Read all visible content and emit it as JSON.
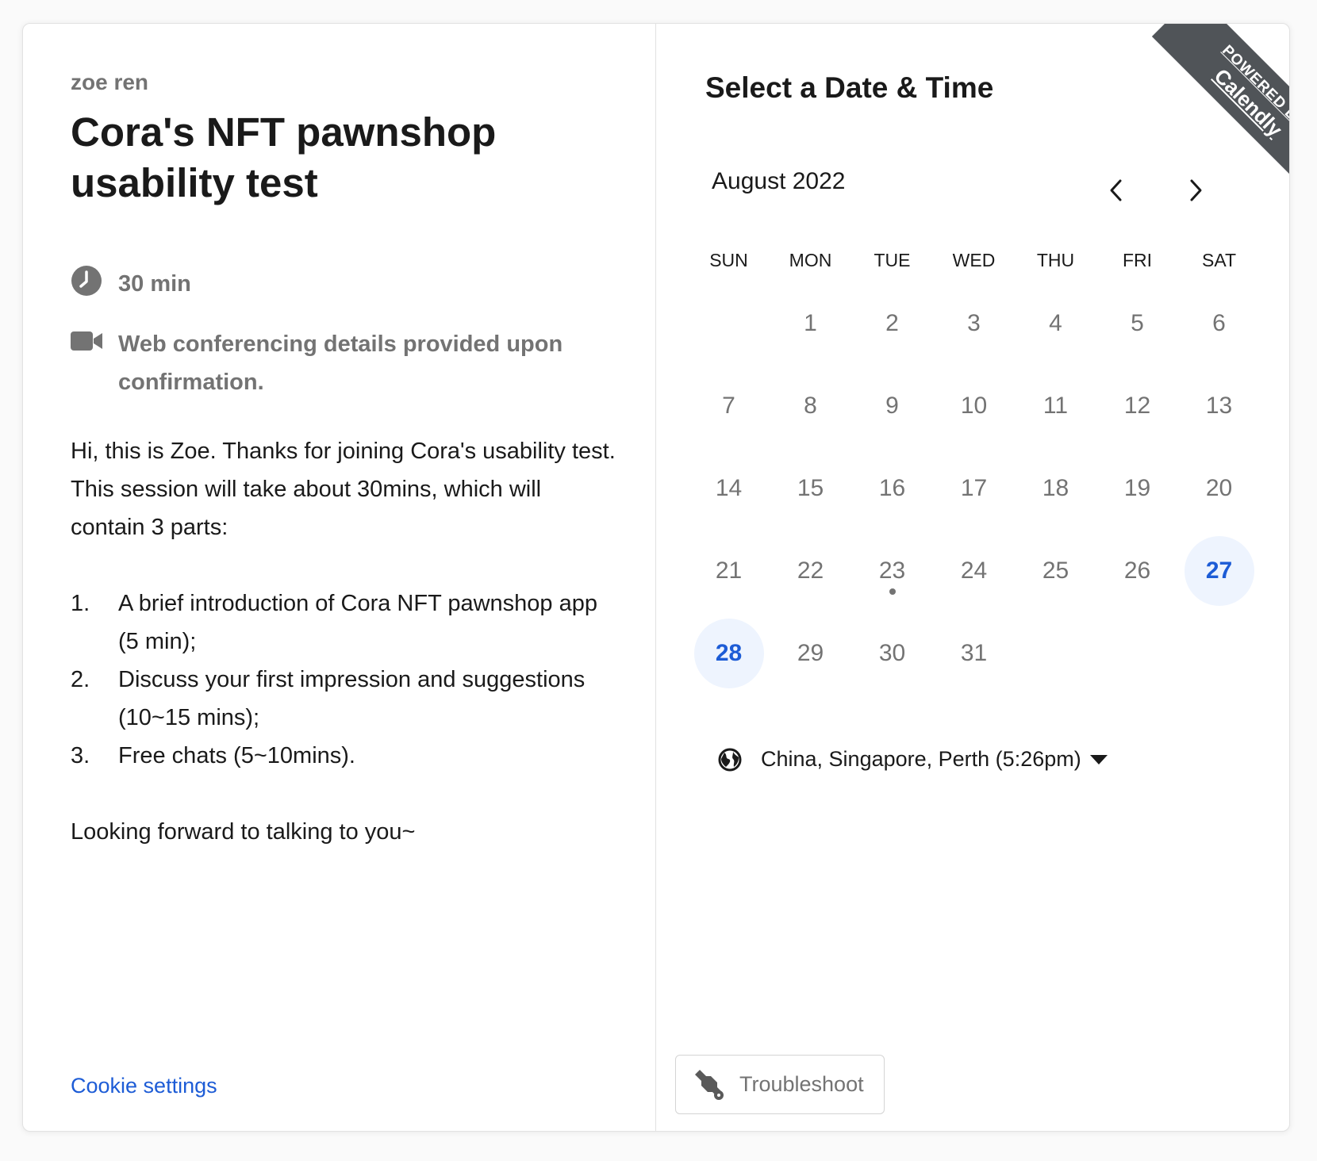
{
  "organizer": "zoe ren",
  "event": {
    "title": "Cora's NFT pawnshop usability test",
    "duration": "30 min",
    "conferencing": "Web conferencing details provided upon confirmation."
  },
  "description": {
    "intro": "Hi, this is Zoe. Thanks for joining Cora's usability test. This session will take about 30mins, which will contain 3 parts:",
    "items": [
      {
        "num": "1.",
        "text": "A brief introduction of Cora NFT pawnshop app (5 min);"
      },
      {
        "num": "2.",
        "text": "Discuss your first impression and suggestions (10~15 mins);"
      },
      {
        "num": "3.",
        "text": "Free chats (5~10mins)."
      }
    ],
    "closing": "Looking forward to talking to you~"
  },
  "cookie_label": "Cookie settings",
  "picker": {
    "title": "Select a Date & Time",
    "month": "August 2022",
    "weekdays": [
      "SUN",
      "MON",
      "TUE",
      "WED",
      "THU",
      "FRI",
      "SAT"
    ],
    "first_weekday_index": 1,
    "days": [
      "1",
      "2",
      "3",
      "4",
      "5",
      "6",
      "7",
      "8",
      "9",
      "10",
      "11",
      "12",
      "13",
      "14",
      "15",
      "16",
      "17",
      "18",
      "19",
      "20",
      "21",
      "22",
      "23",
      "24",
      "25",
      "26",
      "27",
      "28",
      "29",
      "30",
      "31"
    ],
    "available_days": [
      "27",
      "28"
    ],
    "today": "23"
  },
  "timezone": "China, Singapore, Perth (5:26pm)",
  "troubleshoot_label": "Troubleshoot",
  "ribbon": {
    "line1": "POWERED BY",
    "line2": "Calendly"
  },
  "colors": {
    "accent": "#1d5cd6",
    "available_bg": "#eef4fe",
    "muted": "#737373",
    "ribbon": "#505458"
  },
  "icons": {
    "duration": "clock-icon",
    "conferencing": "video-camera-icon",
    "prev": "chevron-left-icon",
    "next": "chevron-right-icon",
    "timezone": "globe-icon",
    "timezone_caret": "caret-down-icon",
    "troubleshoot": "wrench-icon"
  }
}
